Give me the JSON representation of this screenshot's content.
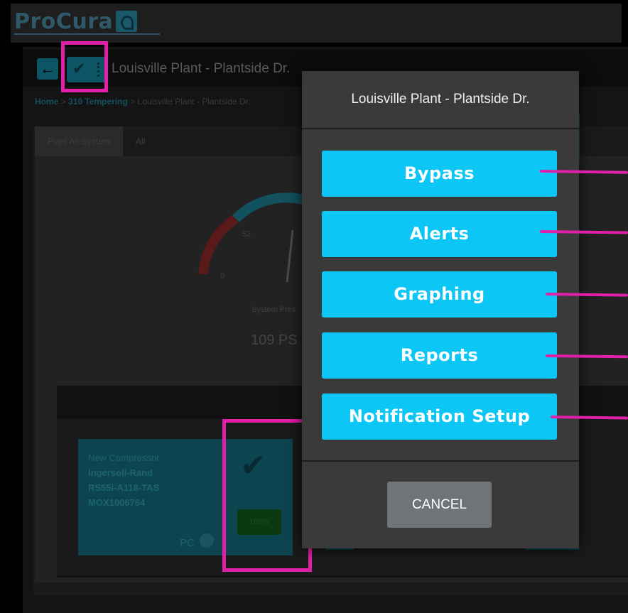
{
  "app": {
    "brand": "ProCura",
    "page_title": "Louisville Plant - Plantside Dr.",
    "breadcrumb": {
      "home": "Home",
      "sep1": " > ",
      "site": "310 Tempering",
      "sep2": " > ",
      "plant": "Louisville Plant - Plantside Dr."
    },
    "tabs": [
      "Plant Air System",
      "All"
    ],
    "gauge": {
      "tick_52": "52",
      "tick_0": "0",
      "caption": "System Pres",
      "value": "109 PS"
    },
    "compressor_card": {
      "name": "New Compressor",
      "make": "Ingersoll-Rand",
      "model": "RS55i-A118-TAS",
      "serial": "MOX1006764",
      "percent": "100%",
      "pc_label": "PC"
    }
  },
  "modal": {
    "title": "Louisville Plant - Plantside Dr.",
    "buttons": [
      "Bypass",
      "Alerts",
      "Graphing",
      "Reports",
      "Notification Setup"
    ],
    "cancel": "CANCEL"
  },
  "colors": {
    "accent": "#0cc6f5",
    "annotation": "#e21fa8",
    "modal_bg": "#3a3a3a",
    "cancel_bg": "#6f7478"
  }
}
